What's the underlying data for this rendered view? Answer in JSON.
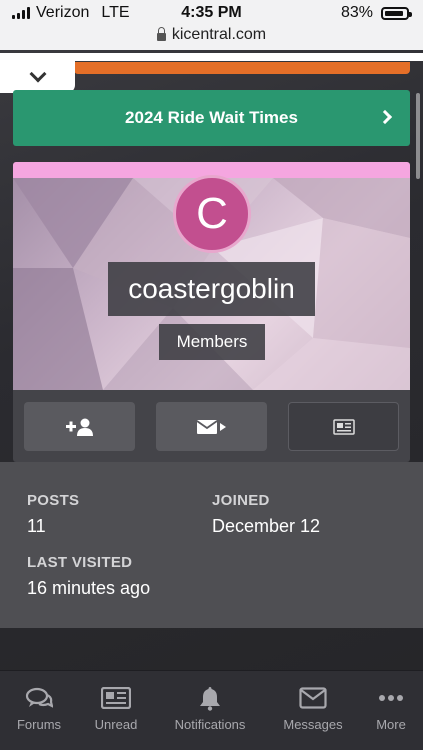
{
  "status_bar": {
    "carrier": "Verizon",
    "network": "LTE",
    "time": "4:35 PM",
    "battery": "83%",
    "url": "kicentral.com"
  },
  "banner": {
    "wait_times_label": "2024 Ride Wait Times"
  },
  "profile": {
    "avatar_letter": "C",
    "username": "coastergoblin",
    "group": "Members"
  },
  "actions": {
    "follow_icon": "add-user-icon",
    "message_icon": "envelope-icon",
    "content_icon": "newspaper-icon"
  },
  "stats": {
    "posts_label": "POSTS",
    "posts_value": "11",
    "joined_label": "JOINED",
    "joined_value": "December 12",
    "last_visited_label": "LAST VISITED",
    "last_visited_value": "16 minutes ago"
  },
  "tabbar": {
    "items": [
      {
        "label": "Forums",
        "icon": "chat-bubbles-icon"
      },
      {
        "label": "Unread",
        "icon": "newspaper-icon"
      },
      {
        "label": "Notifications",
        "icon": "bell-icon"
      },
      {
        "label": "Messages",
        "icon": "envelope-icon"
      },
      {
        "label": "More",
        "icon": "more-dots-icon"
      }
    ]
  },
  "colors": {
    "accent_green": "#2a9770",
    "accent_orange": "#e46f28",
    "pink_bar": "#f5a6e0",
    "avatar_bg": "#c24f8f"
  }
}
